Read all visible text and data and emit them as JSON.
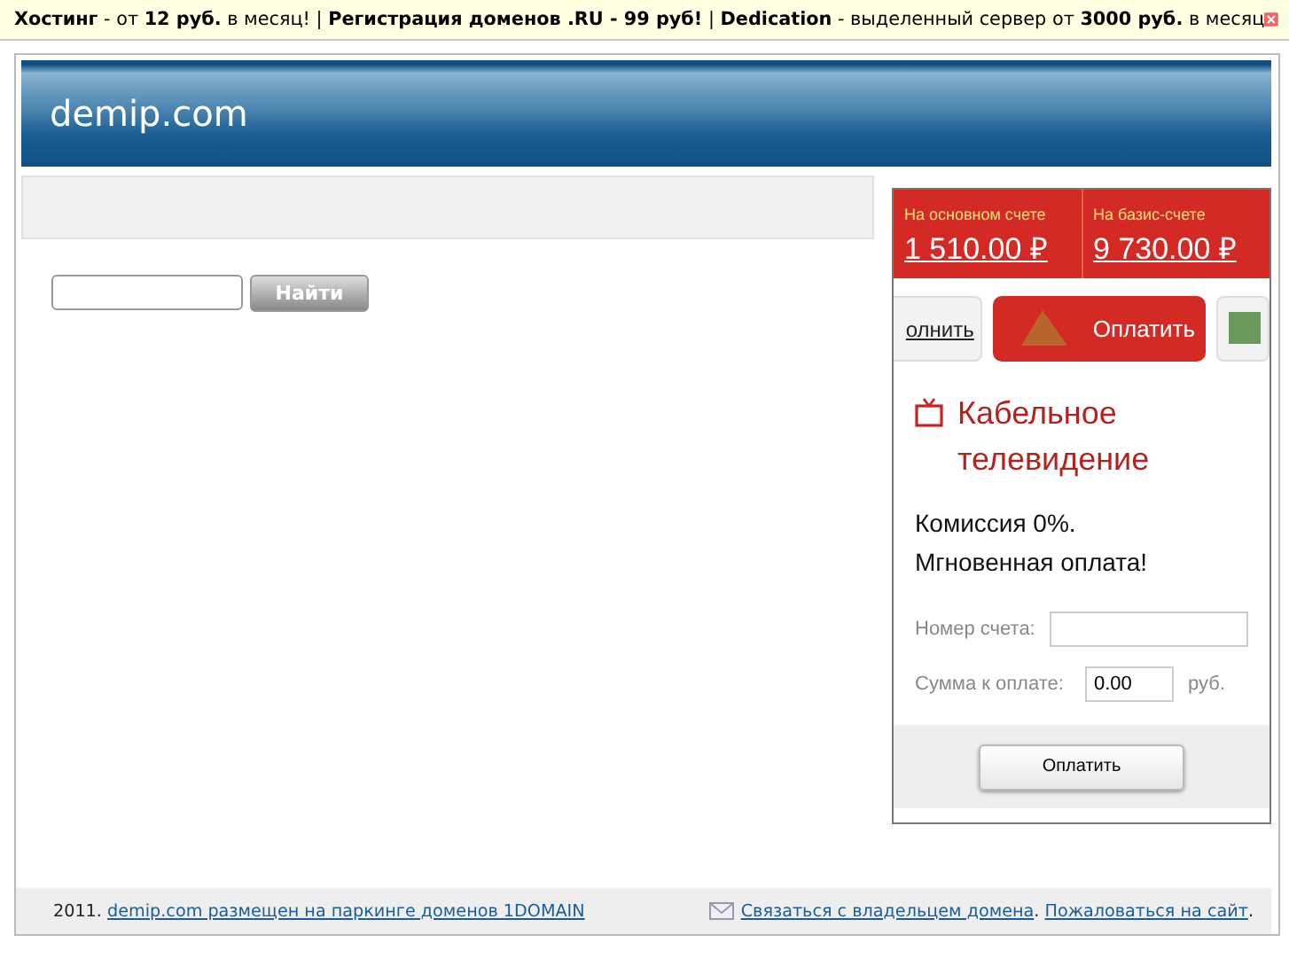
{
  "top_bar": {
    "text": "**Хостинг** - от **12 руб.** в месяц! | **Регистрация доменов .RU - 99 руб!** | **Dedication** - выделенный сервер от **3000 руб.** в месяц"
  },
  "header": {
    "title": "demip.com"
  },
  "search": {
    "button": "Найти"
  },
  "ad": {
    "balances": [
      {
        "label": "На основном счете",
        "amount": "1 510.00 ₽"
      },
      {
        "label": "На базис-счете",
        "amount": "9 730.00 ₽"
      }
    ],
    "actions": [
      {
        "kind": "link",
        "label": "олнить"
      },
      {
        "kind": "primary",
        "label": "Оплатить"
      },
      {
        "kind": "icon"
      }
    ],
    "title": "Кабельное телевидение",
    "promo": [
      "Комиссия 0%.",
      "Мгновенная оплата!"
    ],
    "fields": [
      {
        "label": "Номер счета:"
      },
      {
        "label": "Сумма к оплате:",
        "value": "0.00",
        "unit": "руб."
      }
    ],
    "submit": "Оплатить"
  },
  "footer": {
    "year": "2011.",
    "parking_link": "demip.com размещен на паркинге доменов 1DOMAIN",
    "links": [
      {
        "label": "Связаться с владельцем домена",
        "punct": "."
      },
      {
        "label": "Пожаловаться на сайт",
        "punct": "."
      }
    ]
  }
}
